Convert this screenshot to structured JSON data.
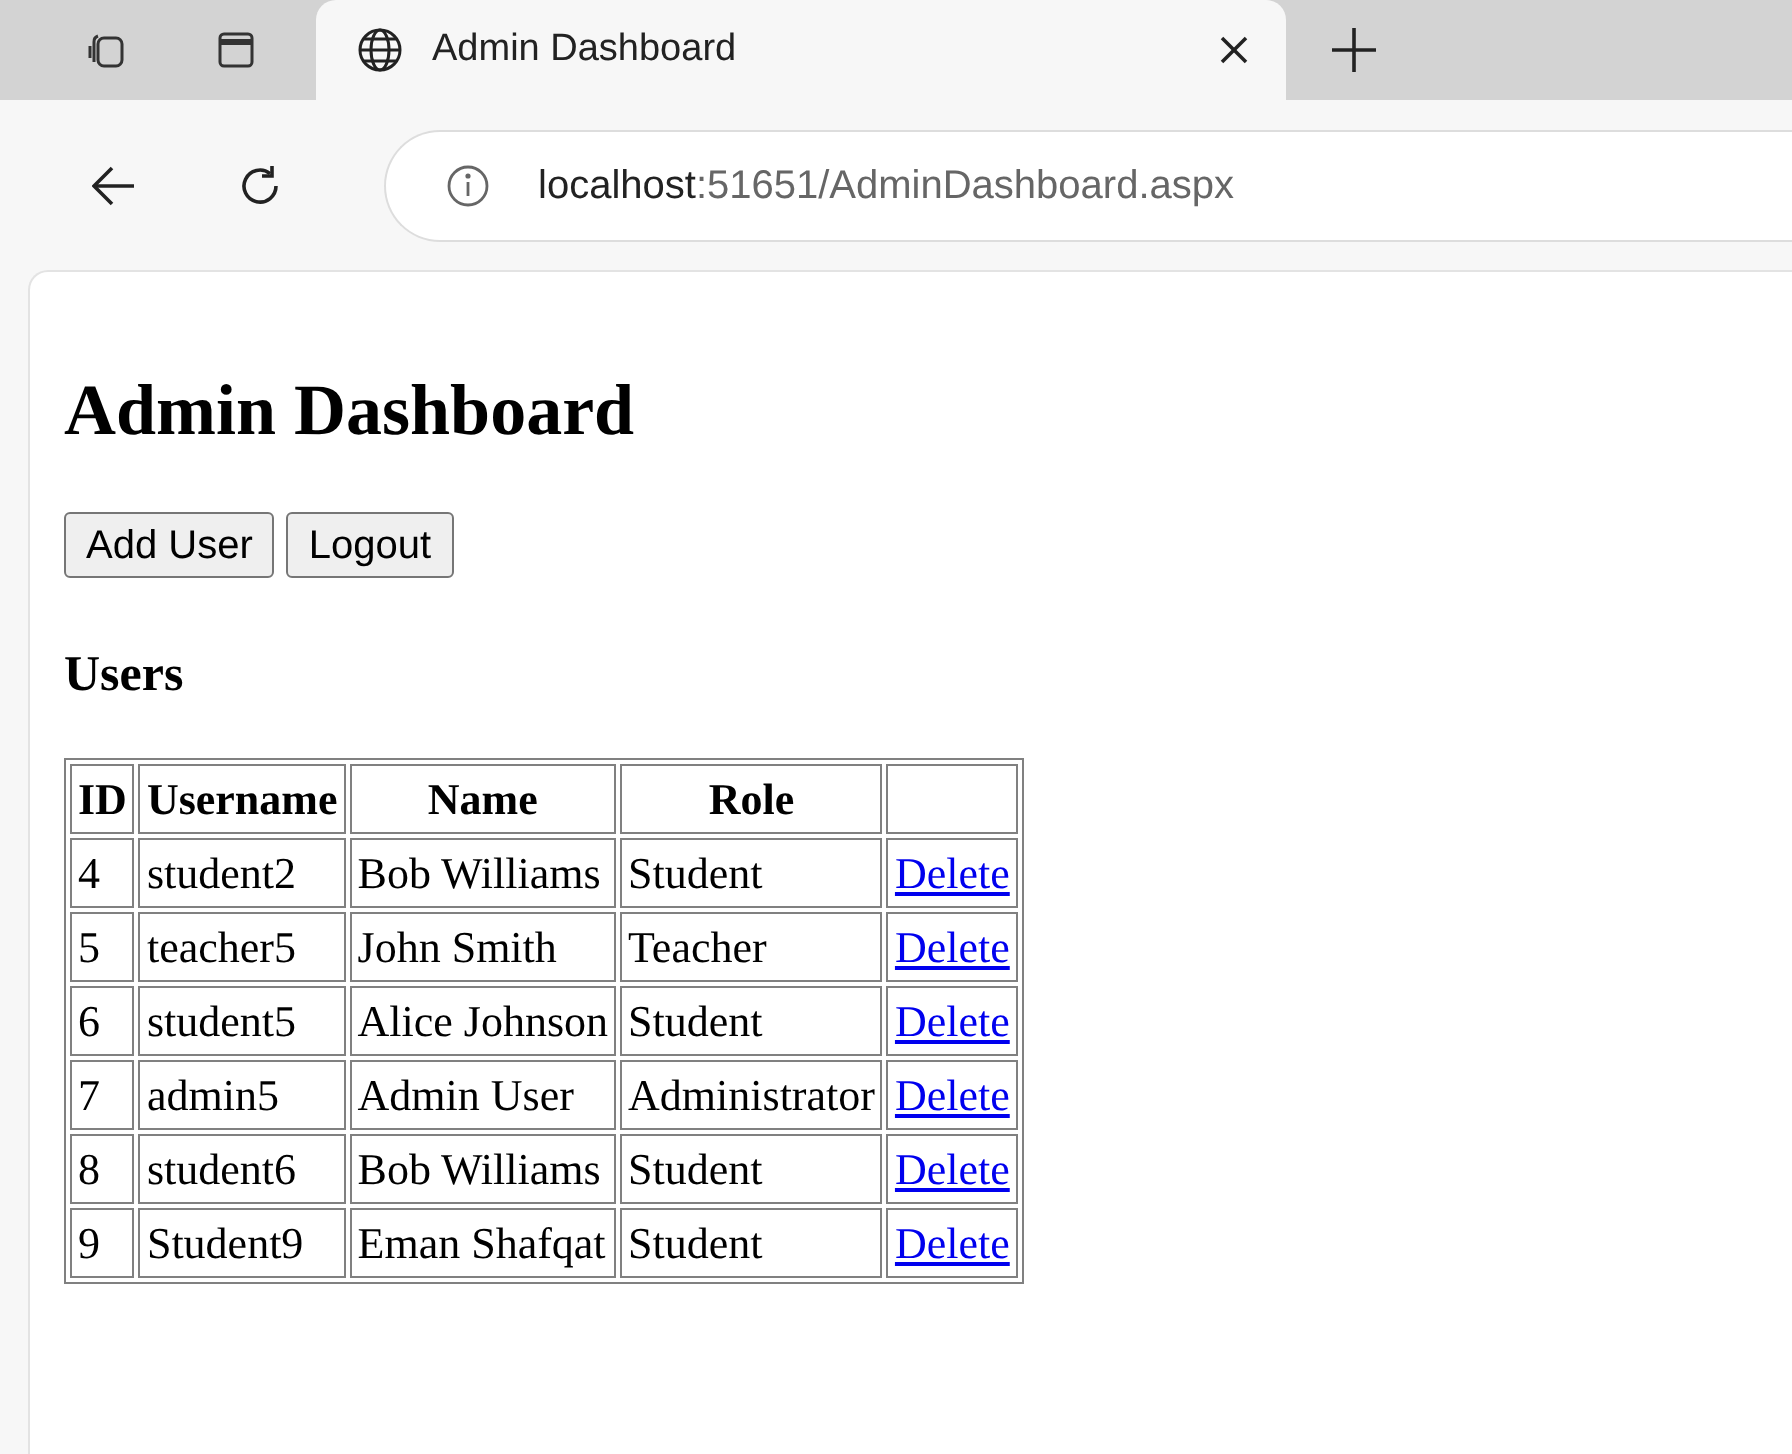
{
  "browser": {
    "tabs": [
      {
        "title": "Admin Dashboard",
        "selected": true
      }
    ],
    "address": {
      "host": "localhost",
      "path": ":51651/AdminDashboard.aspx"
    }
  },
  "page": {
    "heading": "Admin Dashboard",
    "buttons": [
      "Add User",
      "Logout"
    ],
    "section_title": "Users",
    "table": {
      "columns": [
        "ID",
        "Username",
        "Name",
        "Role"
      ],
      "rows": [
        {
          "id": "4",
          "username": "student2",
          "name": "Bob Williams",
          "role": "Student",
          "action": "Delete"
        },
        {
          "id": "5",
          "username": "teacher5",
          "name": "John Smith",
          "role": "Teacher",
          "action": "Delete"
        },
        {
          "id": "6",
          "username": "student5",
          "name": "Alice Johnson",
          "role": "Student",
          "action": "Delete"
        },
        {
          "id": "7",
          "username": "admin5",
          "name": "Admin User",
          "role": "Administrator",
          "action": "Delete"
        },
        {
          "id": "8",
          "username": "student6",
          "name": "Bob Williams",
          "role": "Student",
          "action": "Delete"
        },
        {
          "id": "9",
          "username": "Student9",
          "name": "Eman Shafqat",
          "role": "Student",
          "action": "Delete"
        }
      ]
    }
  }
}
